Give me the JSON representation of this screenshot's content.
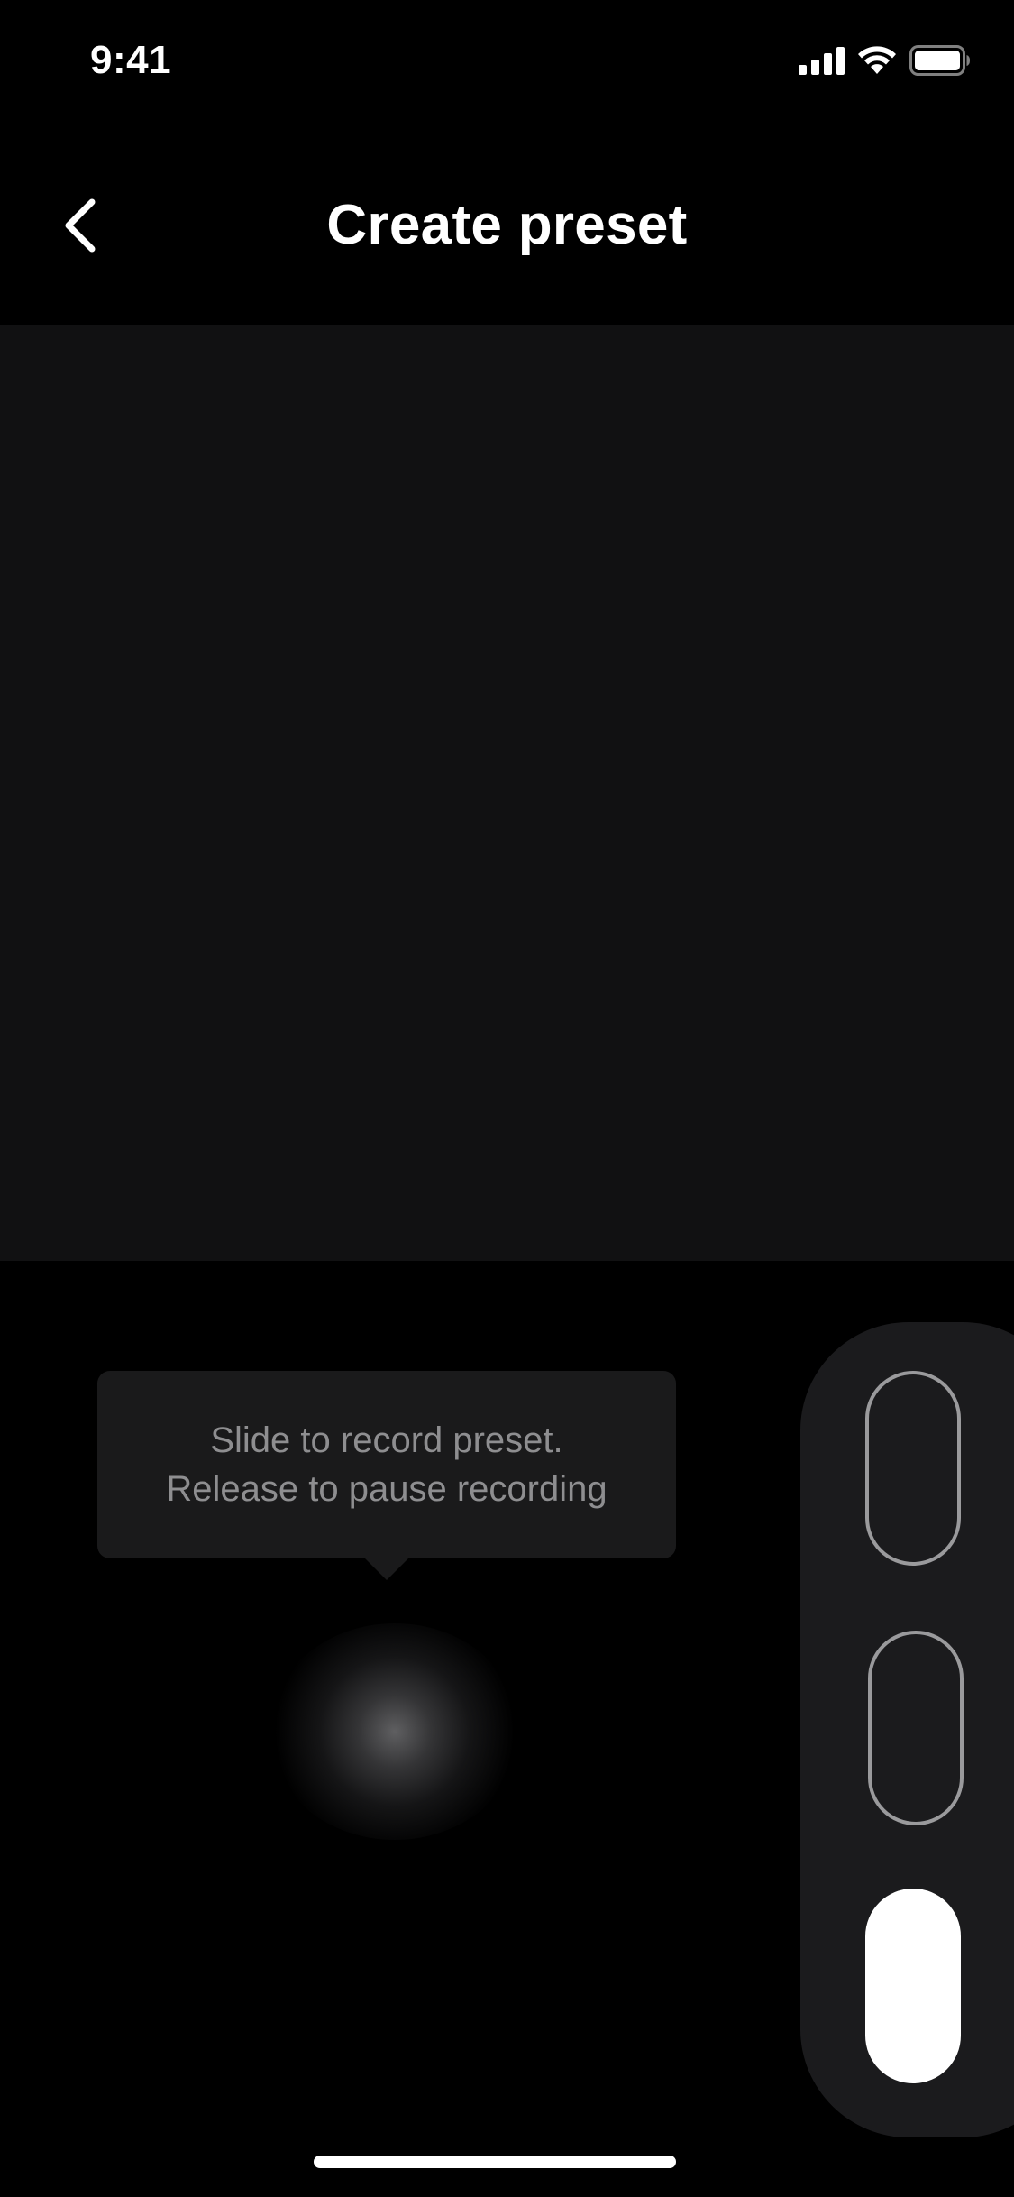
{
  "status_bar": {
    "time": "9:41",
    "icons": [
      "cellular-signal-icon",
      "wifi-icon",
      "battery-icon"
    ]
  },
  "nav": {
    "back_icon": "chevron-left-icon",
    "title": "Create preset"
  },
  "tooltip": {
    "line1": "Slide to record preset.",
    "line2": "Release to pause recording"
  },
  "slider": {
    "slots": [
      "outline",
      "outline",
      "filled"
    ],
    "active_index": 2
  },
  "colors": {
    "background": "#000000",
    "preview": "#111112",
    "panel": "#1b1b1d",
    "tooltip_bg": "#1a1a1b",
    "tooltip_text": "#8e8e90",
    "accent": "#ffffff"
  }
}
